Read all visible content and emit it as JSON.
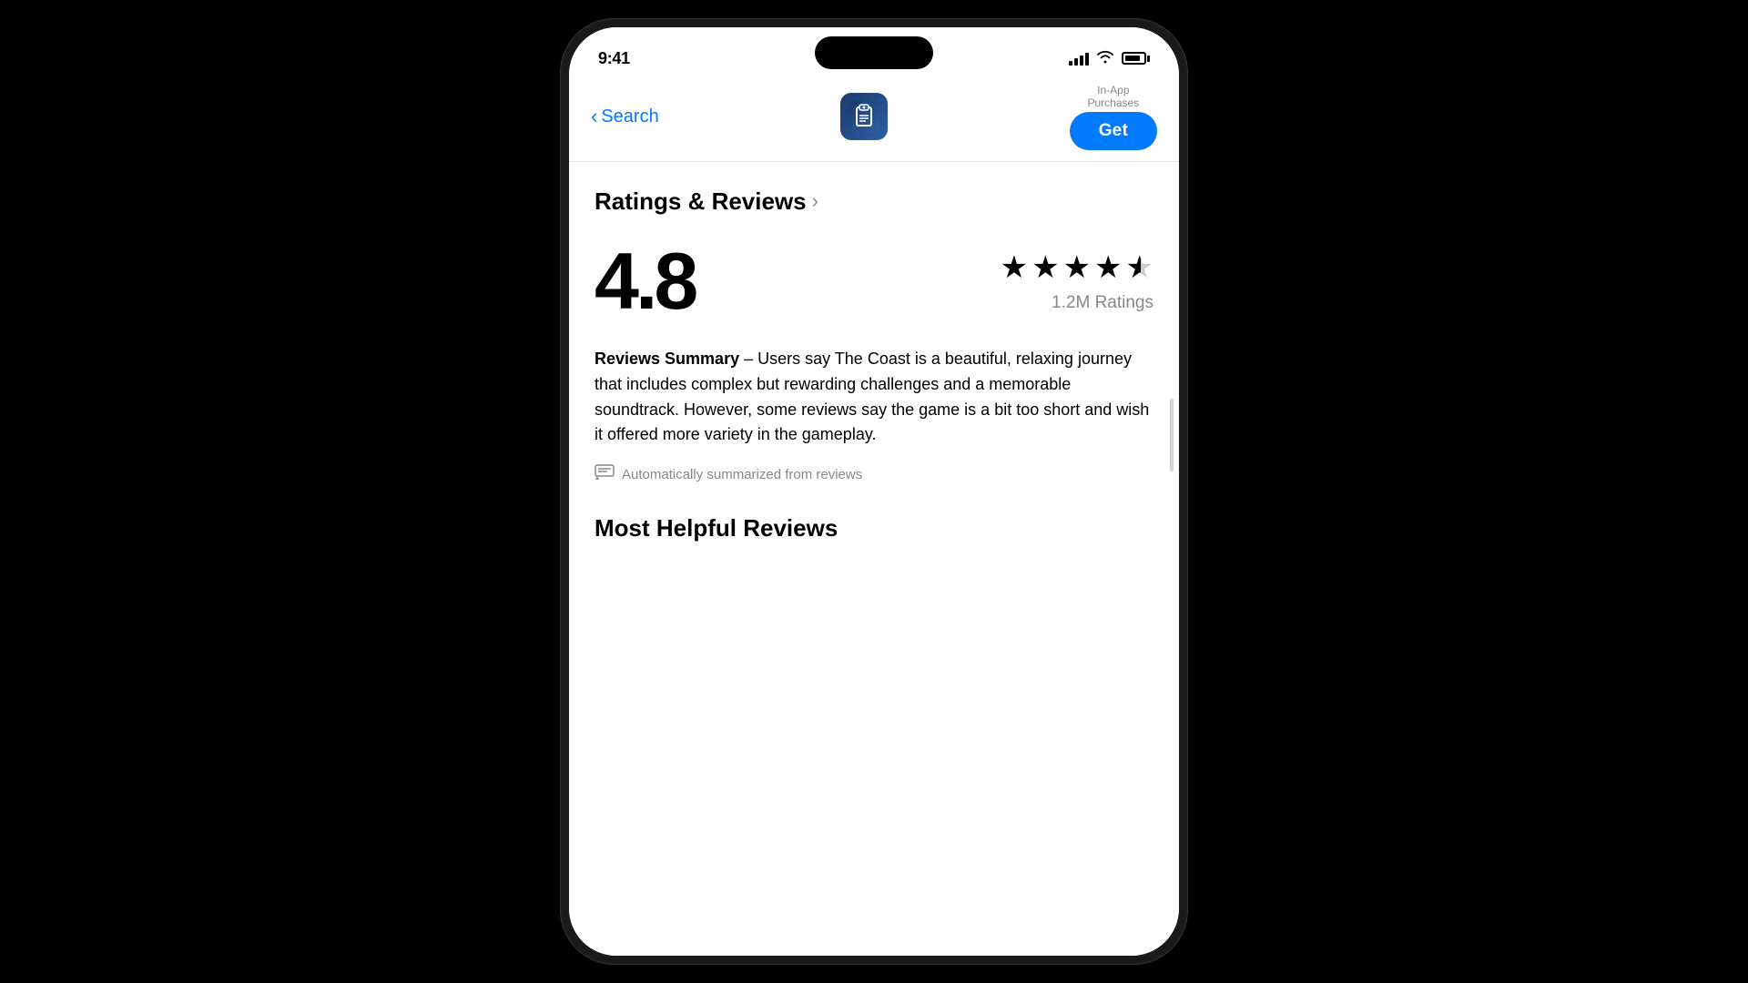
{
  "phone": {
    "status_bar": {
      "time": "9:41",
      "signal_bars": [
        6,
        9,
        12,
        15
      ],
      "wifi": "wifi",
      "battery_level": 85
    },
    "nav": {
      "back_label": "Search",
      "in_app_line1": "In-App",
      "in_app_line2": "Purchases",
      "get_button": "Get"
    },
    "content": {
      "ratings_section_title": "Ratings & Reviews",
      "rating_value": "4.8",
      "stars_count": 4.8,
      "ratings_count": "1.2M Ratings",
      "summary_label": "Reviews Summary",
      "summary_text": " – Users say The Coast is a beautiful, relaxing journey that includes complex but rewarding challenges and a memorable soundtrack. However, some reviews say the game is a bit too short and wish it offered more variety in the gameplay.",
      "auto_summary_text": "Automatically summarized from reviews",
      "most_helpful_title": "Most Helpful Reviews"
    }
  }
}
